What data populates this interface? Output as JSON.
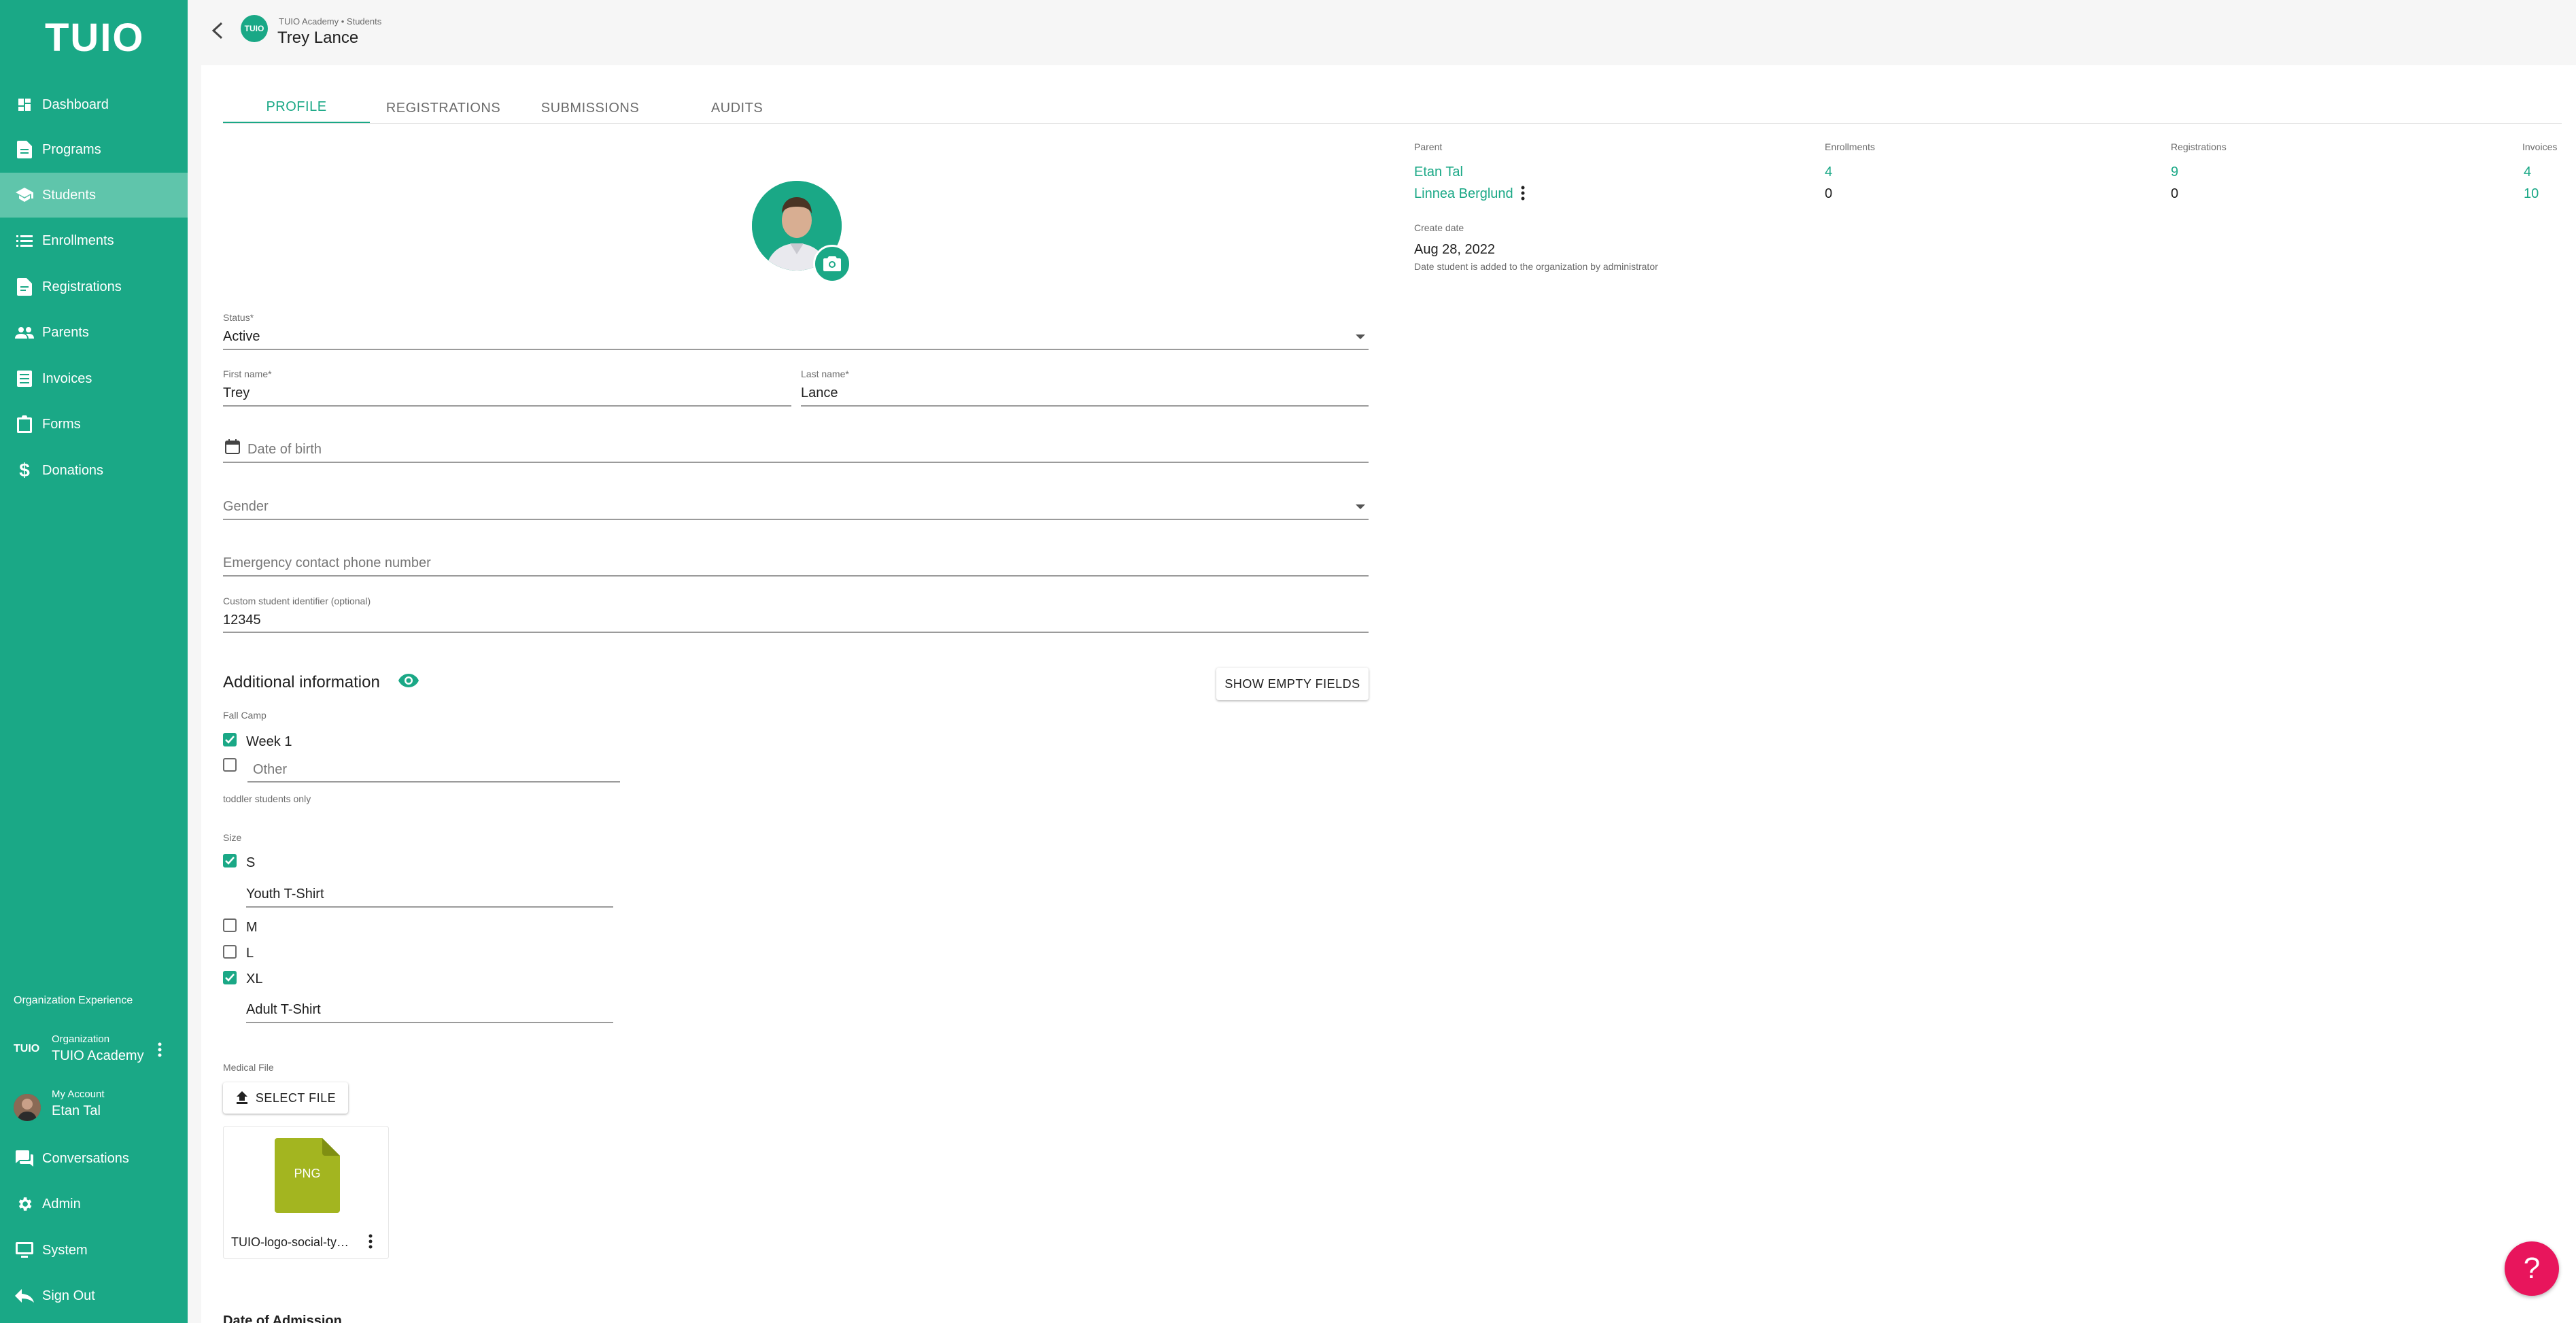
{
  "sidebar": {
    "logo": "TUIO",
    "items": [
      {
        "label": "Dashboard",
        "icon": "dashboard-icon"
      },
      {
        "label": "Programs",
        "icon": "programs-icon"
      },
      {
        "label": "Students",
        "icon": "students-icon",
        "active": true
      },
      {
        "label": "Enrollments",
        "icon": "list-icon"
      },
      {
        "label": "Registrations",
        "icon": "registrations-icon"
      },
      {
        "label": "Parents",
        "icon": "people-icon"
      },
      {
        "label": "Invoices",
        "icon": "invoice-icon"
      },
      {
        "label": "Forms",
        "icon": "clipboard-icon"
      },
      {
        "label": "Donations",
        "icon": "dollar-icon"
      }
    ],
    "org_experience": "Organization Experience",
    "org_logo": "TUIO",
    "org_label": "Organization",
    "org_name": "TUIO Academy",
    "account_label": "My Account",
    "account_name": "Etan Tal",
    "bottom_items": [
      {
        "label": "Conversations",
        "icon": "chat-icon"
      },
      {
        "label": "Admin",
        "icon": "gear-icon"
      },
      {
        "label": "System",
        "icon": "monitor-icon"
      },
      {
        "label": "Sign Out",
        "icon": "sign-out-icon"
      }
    ]
  },
  "header": {
    "logo_text": "TUIO",
    "breadcrumb": "TUIO Academy • Students",
    "title": "Trey Lance"
  },
  "tabs": [
    "PROFILE",
    "REGISTRATIONS",
    "SUBMISSIONS",
    "AUDITS"
  ],
  "form": {
    "status_label": "Status*",
    "status_value": "Active",
    "first_name_label": "First name*",
    "first_name_value": "Trey",
    "last_name_label": "Last name*",
    "last_name_value": "Lance",
    "dob_placeholder": "Date of birth",
    "gender_placeholder": "Gender",
    "emergency_placeholder": "Emergency contact phone number",
    "custom_id_label": "Custom student identifier (optional)",
    "custom_id_value": "12345"
  },
  "additional": {
    "title": "Additional information",
    "show_empty_label": "SHOW EMPTY FIELDS",
    "fall_camp_label": "Fall Camp",
    "week1_label": "Week 1",
    "other_placeholder": "Other",
    "fall_camp_help": "toddler students only",
    "size_label": "Size",
    "size_s": "S",
    "size_s_note": "Youth T-Shirt",
    "size_m": "M",
    "size_l": "L",
    "size_xl": "XL",
    "size_xl_note": "Adult T-Shirt",
    "medical_file_label": "Medical File",
    "select_file_label": "SELECT FILE",
    "file_type": "PNG",
    "file_name": "TUIO-logo-social-type.png",
    "file_color": "#a3b520",
    "date_admission_label": "Date of Admission"
  },
  "right_panel": {
    "parent_header": "Parent",
    "enrollments_header": "Enrollments",
    "registrations_header": "Registrations",
    "invoices_header": "Invoices",
    "parents": [
      {
        "name": "Etan Tal",
        "enrollments": "4",
        "registrations": "9",
        "invoices": "4"
      },
      {
        "name": "Linnea Berglund",
        "enrollments": "0",
        "registrations": "0",
        "invoices": "10"
      }
    ],
    "create_date_label": "Create date",
    "create_date_value": "Aug 28, 2022",
    "create_date_help": "Date student is added to the organization by administrator"
  },
  "help_fab": "?",
  "colors": {
    "brand": "#1aa886",
    "sidebar_active": "#5fc5ab",
    "fab": "#e8155c"
  }
}
